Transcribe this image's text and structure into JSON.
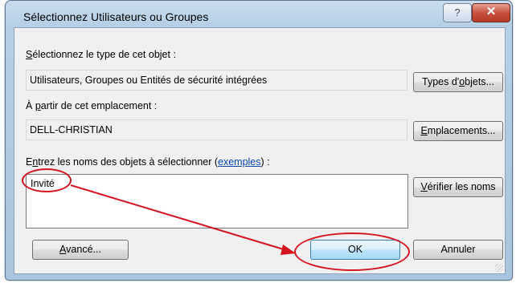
{
  "window": {
    "title": "Sélectionnez Utilisateurs ou Groupes",
    "help_label": "?",
    "close_label": "✕"
  },
  "object_type": {
    "label_prefix": "S",
    "label_rest": "électionnez le type de cet objet :",
    "value": "Utilisateurs, Groupes ou Entités de sécurité intégrées",
    "button_before": "Types d'",
    "button_mnemonic": "o",
    "button_after": "bjets..."
  },
  "location": {
    "label_before": "À ",
    "label_mnemonic": "p",
    "label_after": "artir de cet emplacement :",
    "value": "DELL-CHRISTIAN",
    "button_mnemonic": "E",
    "button_rest": "mplacements..."
  },
  "names": {
    "label_before": "E",
    "label_mnemonic": "n",
    "label_after": "trez les noms des objets à sélectionner (",
    "link": "exemples",
    "label_end": ") :",
    "value": "Invité",
    "check_mnemonic": "V",
    "check_rest": "érifier les noms"
  },
  "footer": {
    "advanced_mnemonic": "A",
    "advanced_rest": "vancé...",
    "ok_label": "OK",
    "cancel_label": "Annuler"
  },
  "annotation": {
    "color": "#d4141e"
  }
}
